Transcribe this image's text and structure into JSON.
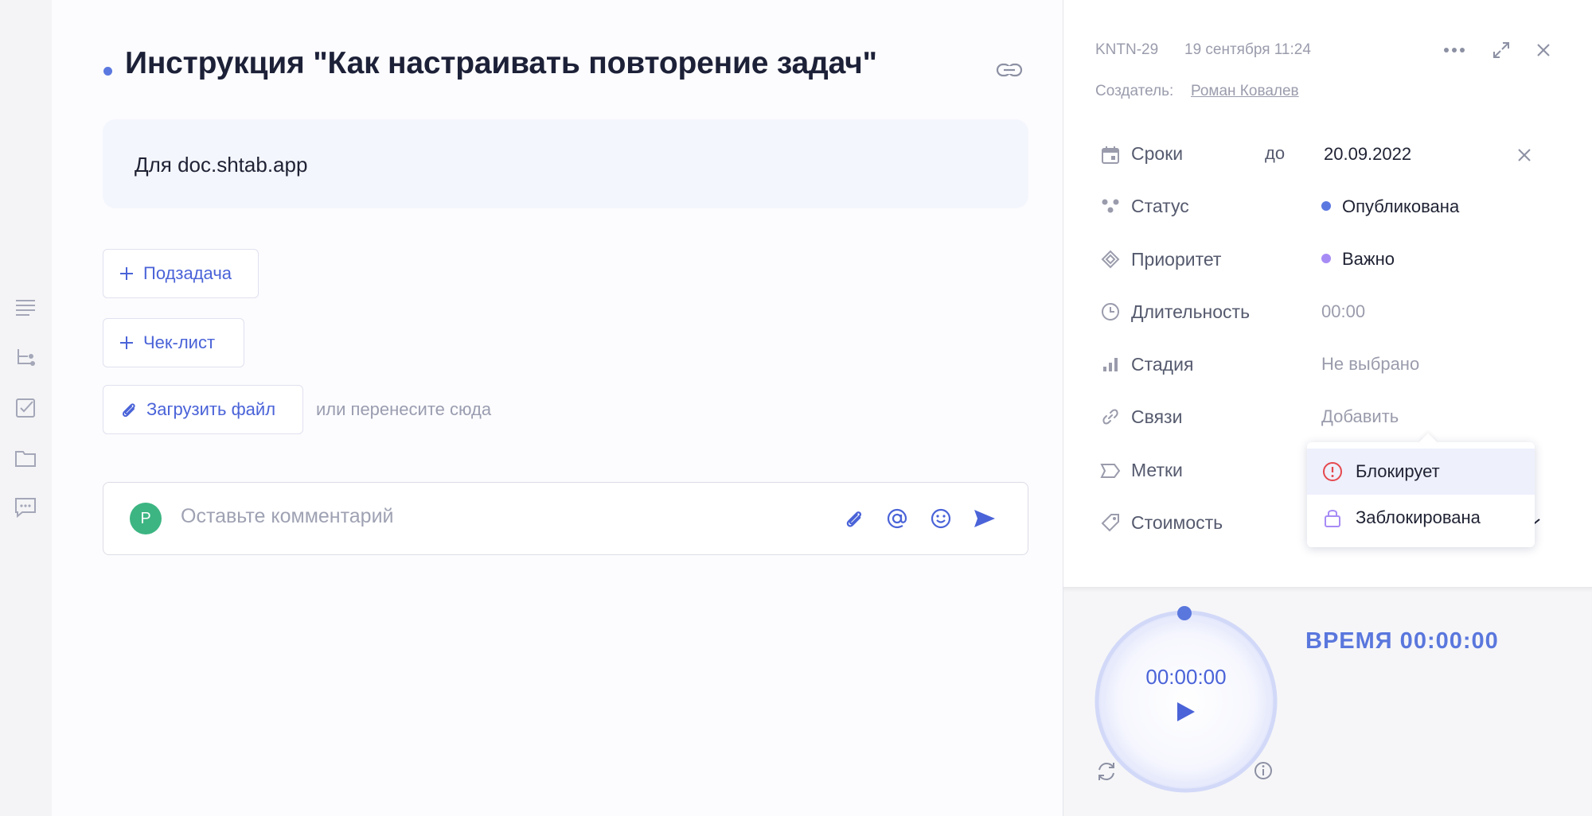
{
  "task": {
    "title": "Инструкция \"Как настраивать повторение задач\"",
    "description": "Для doc.shtab.app"
  },
  "actions": {
    "subtask_label": "Подзадача",
    "checklist_label": "Чек-лист",
    "upload_label": "Загрузить файл",
    "upload_hint": "или перенесите сюда"
  },
  "comment": {
    "avatar_letter": "Р",
    "placeholder": "Оставьте комментарий"
  },
  "panel": {
    "task_id": "KNTN-29",
    "created_at": "19 сентября 11:24",
    "creator_label": "Создатель:",
    "creator_name": "Роман Ковалев",
    "props": {
      "deadline": {
        "label": "Сроки",
        "prefix": "до",
        "value": "20.09.2022"
      },
      "status": {
        "label": "Статус",
        "value": "Опубликована",
        "color": "#5b78e0"
      },
      "priority": {
        "label": "Приоритет",
        "value": "Важно",
        "color": "#a78bf5"
      },
      "duration": {
        "label": "Длительность",
        "value": "00:00"
      },
      "stage": {
        "label": "Стадия",
        "value": "Не выбрано"
      },
      "links": {
        "label": "Связи",
        "value": "Добавить"
      },
      "tags": {
        "label": "Метки"
      },
      "cost": {
        "label": "Стоимость"
      }
    },
    "links_menu": [
      {
        "label": "Блокирует",
        "icon": "alert-circle-icon"
      },
      {
        "label": "Заблокирована",
        "icon": "lock-icon"
      }
    ]
  },
  "timer": {
    "display": "00:00:00",
    "title": "ВРЕМЯ 00:00:00"
  },
  "colors": {
    "accent": "#4a63d8",
    "description_bg": "#f4f6fe",
    "avatar": "#3cb582",
    "alert": "#e5484d",
    "lock": "#a78bf5"
  }
}
